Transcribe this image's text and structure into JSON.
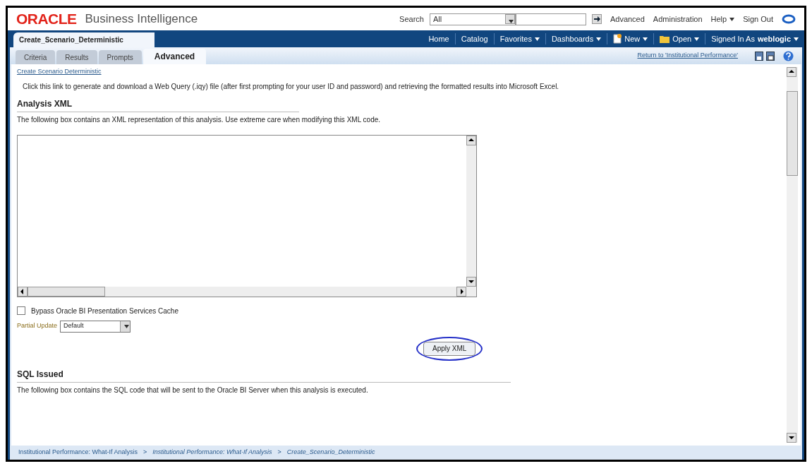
{
  "header": {
    "logo": "ORACLE",
    "product": "Business Intelligence",
    "search_label": "Search",
    "search_scope": "All",
    "links": [
      {
        "label": "Advanced",
        "has_menu": false
      },
      {
        "label": "Administration",
        "has_menu": false
      },
      {
        "label": "Help",
        "has_menu": true
      },
      {
        "label": "Sign Out",
        "has_menu": false
      }
    ]
  },
  "navbar": {
    "title": "Create_Scenario_Deterministic",
    "items": [
      {
        "label": "Home",
        "kind": "plain",
        "has_menu": false
      },
      {
        "label": "Catalog",
        "kind": "plain",
        "has_menu": false
      },
      {
        "label": "Favorites",
        "kind": "plain",
        "has_menu": true
      },
      {
        "label": "Dashboards",
        "kind": "plain",
        "has_menu": true
      },
      {
        "label": "New",
        "kind": "new",
        "has_menu": true
      },
      {
        "label": "Open",
        "kind": "open",
        "has_menu": true
      }
    ],
    "signed_in_label": "Signed In As",
    "user": "weblogic"
  },
  "tabs": [
    {
      "label": "Criteria",
      "selected": false
    },
    {
      "label": "Results",
      "selected": false
    },
    {
      "label": "Prompts",
      "selected": false
    },
    {
      "label": "Advanced",
      "selected": true
    }
  ],
  "return_link": "Return to 'Institutional Performance'",
  "content": {
    "link": "Create Scenario Deterministic",
    "link_description": "Click this link to generate and download a Web Query (.iqy) file (after first prompting for your user ID and password) and retrieving the formatted results into Microsoft Excel.",
    "xml_heading": "Analysis XML",
    "xml_note": "The following box contains an XML representation of this analysis. Use extreme care when modifying this XML code.",
    "bypass_cache": {
      "label": "Bypass Oracle BI Presentation Services Cache",
      "checked": false
    },
    "partial_update": {
      "label": "Partial Update",
      "value": "Default"
    },
    "apply_button": "Apply XML",
    "sql_heading": "SQL Issued",
    "sql_note": "The following box contains the SQL code that will be sent to the Oracle BI Server when this analysis is executed."
  },
  "breadcrumb": {
    "separator": ">",
    "items": [
      {
        "label": "Institutional Performance: What-If Analysis",
        "italic": false
      },
      {
        "label": "Institutional Performance: What-If Analysis",
        "italic": true
      },
      {
        "label": "Create_Scenario_Deterministic",
        "italic": true
      }
    ]
  }
}
